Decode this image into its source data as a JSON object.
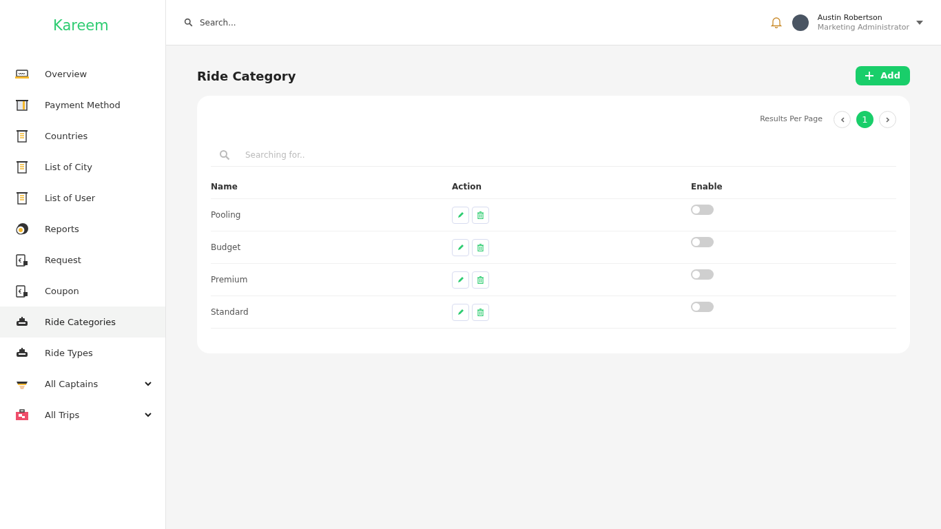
{
  "brand": "Kareem",
  "sidebar": {
    "items": [
      {
        "label": "Overview",
        "kind": "meter",
        "selected": false,
        "submenu": false
      },
      {
        "label": "Payment Method",
        "kind": "card",
        "selected": false,
        "submenu": false
      },
      {
        "label": "Countries",
        "kind": "receipt",
        "selected": false,
        "submenu": false
      },
      {
        "label": "List of City",
        "kind": "receipt",
        "selected": false,
        "submenu": false
      },
      {
        "label": "List of User",
        "kind": "receipt",
        "selected": false,
        "submenu": false
      },
      {
        "label": "Reports",
        "kind": "chat",
        "selected": false,
        "submenu": false
      },
      {
        "label": "Request",
        "kind": "invoice",
        "selected": false,
        "submenu": false
      },
      {
        "label": "Coupon",
        "kind": "invoice",
        "selected": false,
        "submenu": false
      },
      {
        "label": "Ride Categories",
        "kind": "car",
        "selected": true,
        "submenu": false
      },
      {
        "label": "Ride Types",
        "kind": "car",
        "selected": false,
        "submenu": false
      },
      {
        "label": "All Captains",
        "kind": "captain",
        "selected": false,
        "submenu": true
      },
      {
        "label": "All Trips",
        "kind": "suitcase",
        "selected": false,
        "submenu": true
      }
    ]
  },
  "topbar": {
    "search": {
      "placeholder": "Search..."
    },
    "user": {
      "name": "Austin Robertson",
      "role": "Marketing Administrator"
    }
  },
  "page": {
    "title": "Ride Category",
    "add_button": "Add"
  },
  "pagination": {
    "label": "Results Per Page",
    "pages": [
      {
        "label": "1",
        "selected": true
      }
    ]
  },
  "filter": {
    "placeholder": "Searching for.."
  },
  "table": {
    "columns": [
      "Name",
      "Action",
      "Enable"
    ],
    "rows": [
      {
        "name": "Pooling",
        "enabled": false
      },
      {
        "name": "Budget",
        "enabled": false
      },
      {
        "name": "Premium",
        "enabled": false
      },
      {
        "name": "Standard",
        "enabled": false
      }
    ]
  }
}
